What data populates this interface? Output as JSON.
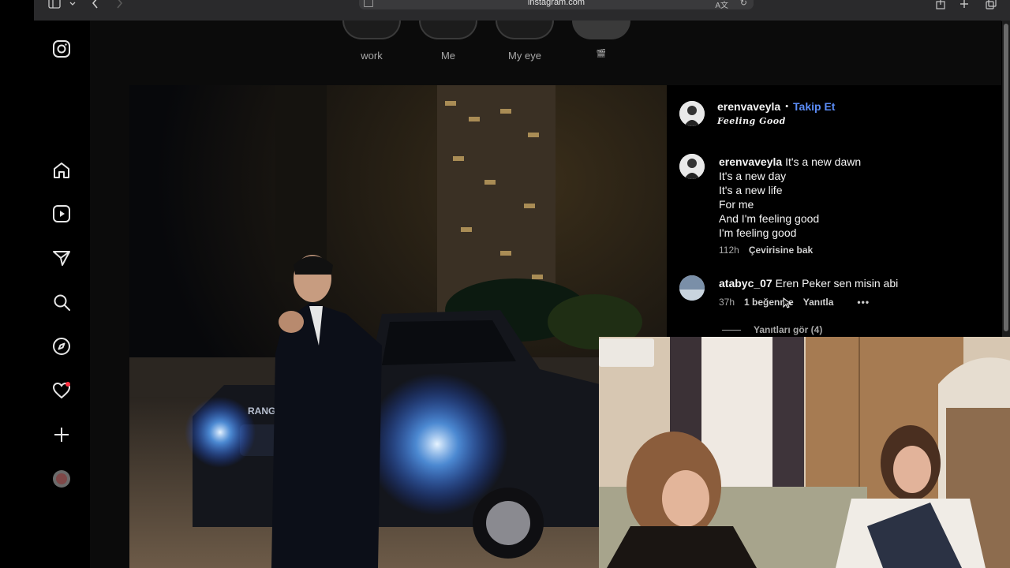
{
  "browser": {
    "url": "instagram.com"
  },
  "highlights": [
    {
      "label": "work"
    },
    {
      "label": "Me"
    },
    {
      "label": "My eye"
    },
    {
      "label": "🎬"
    }
  ],
  "post": {
    "author": "erenvaveyla",
    "follow_label": "Takip Et",
    "separator": "•",
    "song": "Feeling Good",
    "caption": {
      "username": "erenvaveyla",
      "lines": [
        "It's a new dawn",
        "It's a new day",
        "It's a new life",
        "For me",
        "And I'm feeling good",
        "I'm feeling good"
      ],
      "time": "112h",
      "translate_label": "Çevirisine bak"
    },
    "comment": {
      "username": "atabyc_07",
      "text": "Eren Peker sen misin abi",
      "time": "37h",
      "likes": "1 beğenme",
      "reply_label": "Yanıtla",
      "more_icon": "more-dots-icon"
    },
    "view_replies": "Yanıtları gör (4)"
  },
  "colors": {
    "follow_blue": "#5b8cf6",
    "notification_red": "#ff3040"
  }
}
